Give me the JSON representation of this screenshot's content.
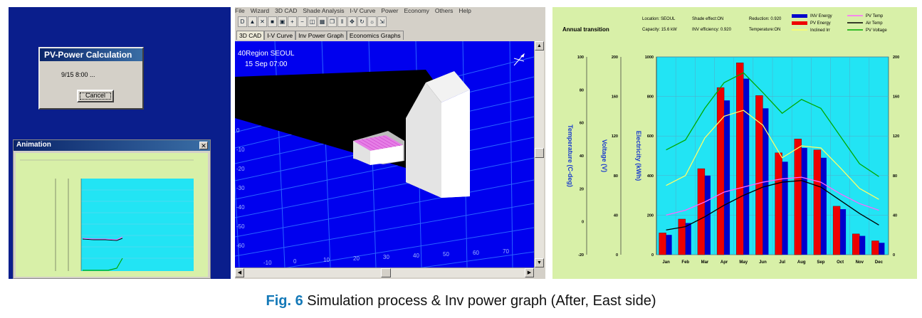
{
  "left": {
    "dialog": {
      "title": "PV-Power Calculation",
      "message": "9/15  8:00 ...",
      "cancel_label": "Cancel"
    },
    "animation_window": {
      "title": "Animation",
      "close_glyph": "✕"
    }
  },
  "mid": {
    "menu": [
      "File",
      "Wizard",
      "3D CAD",
      "Shade Analysis",
      "I-V Curve",
      "Power",
      "Economy",
      "Others",
      "Help"
    ],
    "toolbar_icons": [
      "new-icon",
      "open-icon",
      "close-icon",
      "save-icon",
      "print-icon",
      "zoom-in-icon",
      "zoom-out-icon",
      "zoom-fit-icon",
      "panel-icon",
      "copy-icon",
      "bar-icon",
      "move-icon",
      "rotate-icon",
      "sun-icon",
      "export-icon"
    ],
    "toolbar_glyphs": [
      "D",
      "▲",
      "✕",
      "■",
      "▣",
      "+",
      "−",
      "◫",
      "▦",
      "❐",
      "‖",
      "✥",
      "↻",
      "☼",
      "⇲"
    ],
    "tabs": [
      "3D CAD",
      "I-V Curve",
      "Inv Power Graph",
      "Economics Graphs"
    ],
    "overlay": {
      "region": "Region SEOUL",
      "datetime": "15 Sep 07:00"
    },
    "grid_y_labels": [
      "0",
      "-10",
      "-20",
      "-30",
      "-40",
      "-50",
      "-60"
    ],
    "grid_x_labels": [
      "-10",
      "0",
      "10",
      "20",
      "30",
      "40",
      "50",
      "60",
      "70"
    ],
    "y_prefix": "40",
    "colors": {
      "viewport_bg": "#0000ee",
      "grid": "#2a63ff",
      "shadow": "#000000"
    }
  },
  "right": {
    "panel_title": "Annual transition",
    "info": {
      "location": "Location: SEOUL",
      "capacity": "Capacity: 15.6 kW",
      "shade": "Shade effect:ON",
      "inv_eff": "INV efficiency: 0.920",
      "reduction": "Reduction: 0.920",
      "temperature": "Temperature:ON"
    },
    "colors": {
      "plot_bg": "#22e4f4",
      "inv": "#0000cc",
      "pv": "#ee0000",
      "inclined": "#ffff66",
      "pv_temp": "#ff66ff",
      "air_temp": "#000000",
      "pv_voltage": "#00aa00"
    }
  },
  "chart_data": {
    "type": "bar",
    "title": "Annual transition",
    "categories": [
      "Jan",
      "Feb",
      "Mar",
      "Apr",
      "May",
      "Jun",
      "Jul",
      "Aug",
      "Sep",
      "Oct",
      "Nov",
      "Dec"
    ],
    "ylabel": "Electricity (kWh)",
    "ylim": [
      0,
      1000
    ],
    "yticks": [
      "0",
      "200",
      "400",
      "600",
      "800",
      "1000"
    ],
    "y_temp_label": "Temperature (C-deg)",
    "y_temp_ticks": [
      "-20",
      "0",
      "20",
      "40",
      "60",
      "80",
      "100"
    ],
    "y_temp_lim": [
      -20,
      100
    ],
    "y_volt_label": "Voltage (V)",
    "y_volt_ticks": [
      "0",
      "40",
      "80",
      "120",
      "160",
      "200"
    ],
    "y_volt_lim": [
      0,
      200
    ],
    "y_right_ticks": [
      "0",
      "40",
      "80",
      "120",
      "160",
      "200"
    ],
    "series": [
      {
        "name": "INV Energy",
        "values": [
          100,
          160,
          400,
          780,
          890,
          740,
          470,
          540,
          490,
          230,
          95,
          60
        ]
      },
      {
        "name": "PV Energy",
        "values": [
          110,
          180,
          435,
          845,
          970,
          805,
          515,
          585,
          530,
          245,
          105,
          70
        ]
      },
      {
        "name": "Inclined Irr",
        "values": [
          70,
          80,
          118,
          140,
          146,
          131,
          98,
          110,
          108,
          88,
          67,
          56
        ]
      },
      {
        "name": "PV Temp",
        "values": [
          4,
          7,
          12,
          18,
          21,
          24,
          26,
          27,
          24,
          17,
          11,
          7
        ]
      },
      {
        "name": "Air Temp",
        "values": [
          -5,
          -3,
          3,
          10,
          16,
          21,
          24,
          25,
          21,
          13,
          5,
          -2
        ]
      },
      {
        "name": "PV Voltage",
        "values": [
          106,
          116,
          148,
          174,
          184,
          164,
          143,
          157,
          148,
          120,
          92,
          79
        ]
      }
    ],
    "legend_position": "top-right",
    "grid": true
  },
  "caption": {
    "fig": "Fig. 6",
    "text": " Simulation process & Inv power graph (After, East side)"
  }
}
